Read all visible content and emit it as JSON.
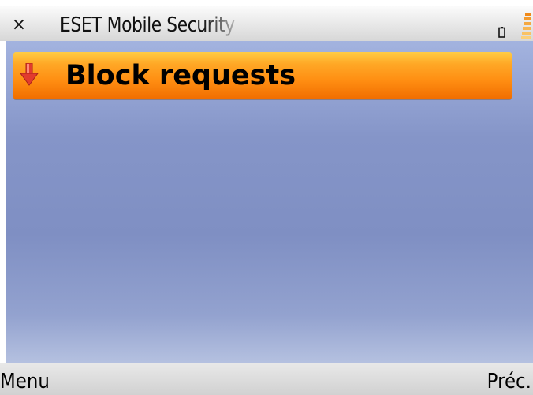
{
  "titlebar": {
    "close_glyph": "×",
    "title": "ESET Mobile Security",
    "battery_icon": "battery-icon",
    "signal_icon": "signal-strength-icon"
  },
  "list": {
    "items": [
      {
        "label": "Block requests",
        "icon": "arrow-down-icon",
        "selected": true
      }
    ]
  },
  "softkeys": {
    "left_label": "Menu",
    "right_label": "Préc."
  },
  "colors": {
    "highlight_top": "#ffcc44",
    "highlight_bottom": "#f06d00",
    "background": "#8595c8",
    "icon_red": "#e23b2e"
  }
}
